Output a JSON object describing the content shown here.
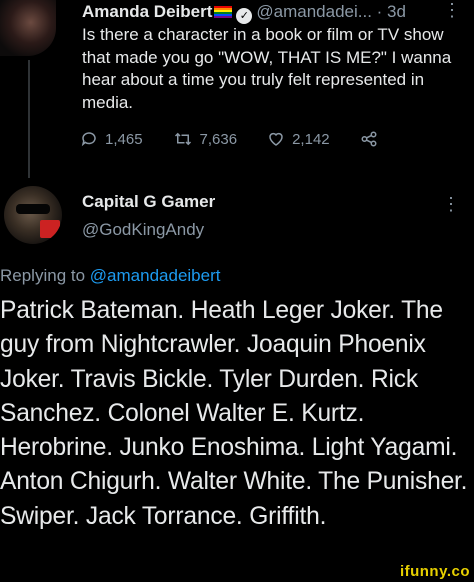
{
  "original_tweet": {
    "name": "Amanda Deibert",
    "handle": "@amandadei...",
    "time": "· 3d",
    "text": "Is there a character in a book or film or TV show that made you go \"WOW, THAT IS ME?\" I wanna hear about a time you truly felt represented in media.",
    "replies": "1,465",
    "retweets": "7,636",
    "likes": "2,142",
    "more_icon": "more-vertical-icon",
    "verified_icon": "verified-badge-icon",
    "flag_icon": "pride-flag-icon"
  },
  "reply": {
    "name": "Capital G Gamer",
    "handle": "@GodKingAndy",
    "replying_prefix": "Replying to",
    "replying_to": "@amandadeibert",
    "text": "Patrick Bateman. Heath Leger Joker. The guy from Nightcrawler. Joaquin Phoenix Joker. Travis Bickle. Tyler Durden. Rick Sanchez. Colonel Walter E. Kurtz. Herobrine. Junko Enoshima. Light Yagami. Anton Chigurh. Walter White. The Punisher. Swiper. Jack Torrance. Griffith."
  },
  "watermark": "ifunny.co"
}
